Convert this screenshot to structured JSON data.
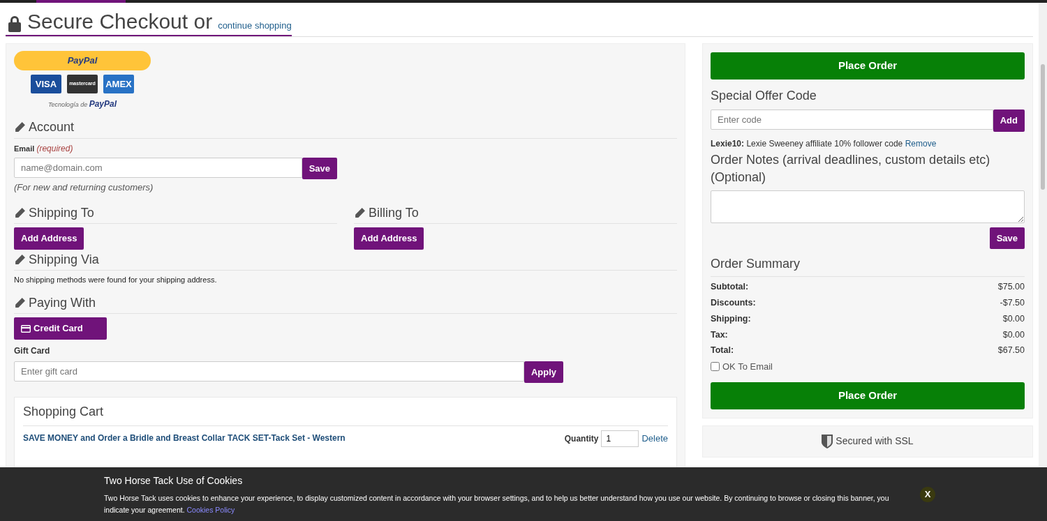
{
  "header": {
    "title": "Secure Checkout or",
    "link": "continue shopping"
  },
  "paypal": {
    "button_label": "PayPal",
    "cards": [
      "VISA",
      "mastercard",
      "AMEX"
    ],
    "powered_by": "Tecnología de",
    "powered_brand": "PayPal"
  },
  "account": {
    "heading": "Account",
    "email_label": "Email",
    "required": "(required)",
    "email_placeholder": "name@domain.com",
    "save": "Save",
    "hint": "(For new and returning customers)"
  },
  "shipping_to": {
    "heading": "Shipping To",
    "button": "Add Address"
  },
  "billing_to": {
    "heading": "Billing To",
    "button": "Add Address"
  },
  "shipping_via": {
    "heading": "Shipping Via",
    "message": "No shipping methods were found for your shipping address."
  },
  "paying_with": {
    "heading": "Paying With",
    "method": "Credit Card"
  },
  "gift_card": {
    "label": "Gift Card",
    "placeholder": "Enter gift card",
    "button": "Apply"
  },
  "cart": {
    "heading": "Shopping Cart",
    "items": [
      {
        "title": "SAVE MONEY and Order a Bridle and Breast Collar TACK SET-Tack Set - Western",
        "quantity_label": "Quantity",
        "quantity": "1",
        "delete": "Delete"
      }
    ]
  },
  "place_order_top": "Place Order",
  "offer": {
    "heading": "Special Offer Code",
    "placeholder": "Enter code",
    "button": "Add",
    "code": "Lexie10:",
    "description": "Lexie Sweeney affiliate 10% follower code",
    "remove": "Remove"
  },
  "notes": {
    "heading": "Order Notes (arrival deadlines, custom details etc) (Optional)",
    "save": "Save"
  },
  "summary": {
    "heading": "Order Summary",
    "rows": [
      {
        "label": "Subtotal:",
        "value": "$75.00"
      },
      {
        "label": "Discounts:",
        "value": "-$7.50"
      },
      {
        "label": "Shipping:",
        "value": "$0.00"
      },
      {
        "label": "Tax:",
        "value": "$0.00"
      },
      {
        "label": "Total:",
        "value": "$67.50"
      }
    ],
    "ok_to_email": {
      "label": "OK To Email",
      "checked": false
    }
  },
  "place_order_bottom": "Place Order",
  "ssl": "Secured with SSL",
  "cookie_banner": {
    "title": "Two Horse Tack Use of Cookies",
    "text": "Two Horse Tack uses cookies to enhance your experience, to display customized content in accordance with your browser settings, and to help us better understand how you use our website. By continuing to browse or closing this banner, you indicate your agreement.",
    "link": "Cookies Policy",
    "close": "X"
  }
}
